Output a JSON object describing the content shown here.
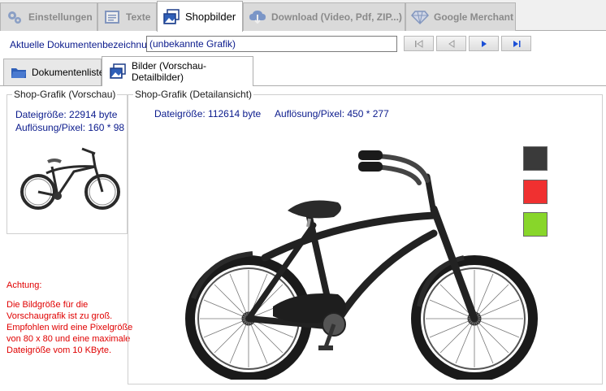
{
  "top_tabs": [
    {
      "label": "Einstellungen",
      "icon": "gears-icon"
    },
    {
      "label": "Texte",
      "icon": "text-document-icon"
    },
    {
      "label": "Shopbilder",
      "icon": "images-icon"
    },
    {
      "label": "Download (Video, Pdf, ZIP...)",
      "icon": "download-cloud-icon"
    },
    {
      "label": "Google Merchant",
      "icon": "diamond-icon"
    }
  ],
  "doc": {
    "label": "Aktuelle Dokumentenbezeichnung:",
    "value": "(unbekannte Grafik)"
  },
  "nav_buttons": [
    {
      "name": "first-record-button",
      "glyph": "first"
    },
    {
      "name": "previous-record-button",
      "glyph": "prev"
    },
    {
      "name": "next-record-button",
      "glyph": "next"
    },
    {
      "name": "last-record-button",
      "glyph": "last"
    }
  ],
  "sub_tabs": [
    {
      "label": "Dokumentenliste"
    },
    {
      "label": "Bilder (Vorschau- Detailbilder)"
    }
  ],
  "preview": {
    "title": "Shop-Grafik (Vorschau)",
    "size": "Dateigröße: 22914 byte",
    "resolution": "Auflösung/Pixel: 160 * 98"
  },
  "detail": {
    "title": "Shop-Grafik (Detailansicht)",
    "size": "Dateigröße: 112614 byte",
    "resolution": "Auflösung/Pixel: 450 * 277"
  },
  "warning": {
    "heading": "Achtung:",
    "line1": "Die Bildgröße für die",
    "line2": "Vorschaugrafik ist zu groß.",
    "line3": "Empfohlen wird eine Pixelgröße",
    "line4": "von 80 x 80 und eine maximale",
    "line5": "Dateigröße vom 10 KByte."
  },
  "color_swatches": [
    {
      "name": "black",
      "color": "#3a3a3a"
    },
    {
      "name": "red",
      "color": "#f03030"
    },
    {
      "name": "green",
      "color": "#88d62a"
    }
  ],
  "colors": {
    "label_blue": "#0a1a8c",
    "warning_red": "#e00000",
    "nav_arrow_blue": "#1b4fd6"
  }
}
